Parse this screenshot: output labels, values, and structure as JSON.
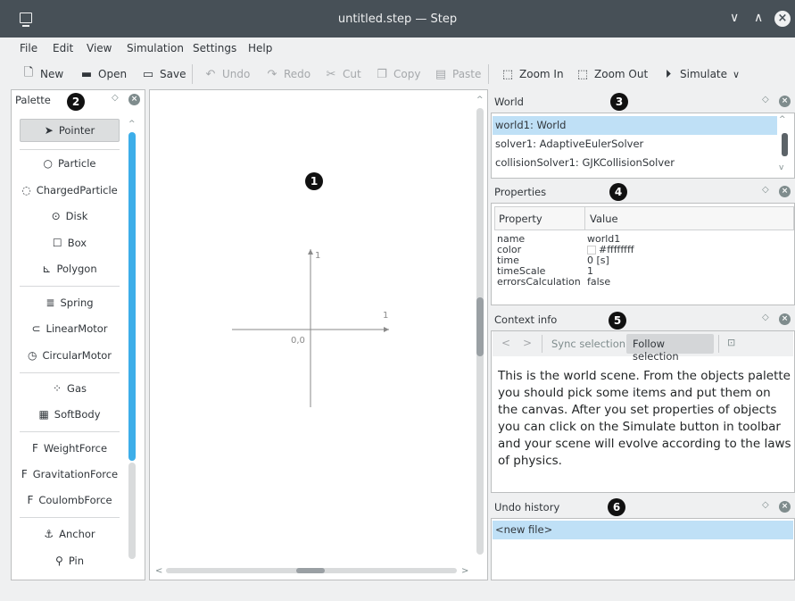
{
  "window": {
    "title": "untitled.step — Step",
    "minimize": "∨",
    "maximize": "∧",
    "close": "×"
  },
  "menu": [
    "File",
    "Edit",
    "View",
    "Simulation",
    "Settings",
    "Help"
  ],
  "toolbar": {
    "new": "New",
    "open": "Open",
    "save": "Save",
    "undo": "Undo",
    "redo": "Redo",
    "cut": "Cut",
    "copy": "Copy",
    "paste": "Paste",
    "zoom_in": "Zoom In",
    "zoom_out": "Zoom Out",
    "simulate": "Simulate",
    "more": "∨"
  },
  "palette": {
    "title": "Palette",
    "badge": "2",
    "items": [
      {
        "label": "Pointer",
        "icon": "pointer-icon",
        "glyph": "➤"
      },
      {
        "label": "Particle",
        "icon": "particle-icon",
        "glyph": "○"
      },
      {
        "label": "ChargedParticle",
        "icon": "charged-particle-icon",
        "glyph": "◌"
      },
      {
        "label": "Disk",
        "icon": "disk-icon",
        "glyph": "⊙"
      },
      {
        "label": "Box",
        "icon": "box-icon",
        "glyph": "☐"
      },
      {
        "label": "Polygon",
        "icon": "polygon-icon",
        "glyph": "⊾"
      },
      {
        "label": "Spring",
        "icon": "spring-icon",
        "glyph": "≣"
      },
      {
        "label": "LinearMotor",
        "icon": "linear-motor-icon",
        "glyph": "⊂"
      },
      {
        "label": "CircularMotor",
        "icon": "circular-motor-icon",
        "glyph": "◷"
      },
      {
        "label": "Gas",
        "icon": "gas-icon",
        "glyph": "⁘"
      },
      {
        "label": "SoftBody",
        "icon": "soft-body-icon",
        "glyph": "▦"
      },
      {
        "label": "WeightForce",
        "icon": "weight-force-icon",
        "glyph": "F"
      },
      {
        "label": "GravitationForce",
        "icon": "gravitation-force-icon",
        "glyph": "F"
      },
      {
        "label": "CoulombForce",
        "icon": "coulomb-force-icon",
        "glyph": "F"
      },
      {
        "label": "Anchor",
        "icon": "anchor-icon",
        "glyph": "⚓"
      },
      {
        "label": "Pin",
        "icon": "pin-icon",
        "glyph": "⚲"
      }
    ]
  },
  "canvas": {
    "badge": "1",
    "axis_y_label": "1",
    "axis_x_label": "1",
    "origin_label": "0,0"
  },
  "world": {
    "title": "World",
    "badge": "3",
    "items": [
      "world1: World",
      "solver1: AdaptiveEulerSolver",
      "collisionSolver1: GJKCollisionSolver"
    ]
  },
  "properties": {
    "title": "Properties",
    "badge": "4",
    "col_property": "Property",
    "col_value": "Value",
    "rows": [
      {
        "name": "name",
        "value": "world1"
      },
      {
        "name": "color",
        "value": "#ffffffff"
      },
      {
        "name": "time",
        "value": "0 [s]"
      },
      {
        "name": "timeScale",
        "value": "1"
      },
      {
        "name": "errorsCalculation",
        "value": "false"
      }
    ],
    "color_swatch": "#ffffff"
  },
  "context": {
    "title": "Context info",
    "badge": "5",
    "back": "<",
    "forward": ">",
    "sync": "Sync selection",
    "follow": "Follow selection",
    "text": "This is the world scene. From the objects palette you should pick some items and put them on the canvas. After you set properties of objects you can click on the Simulate button in toolbar and your scene will evolve according to the laws of physics."
  },
  "undo": {
    "title": "Undo history",
    "badge": "6",
    "items": [
      "<new file>"
    ]
  },
  "colors": {
    "accent": "#3daee9",
    "selection": "#bfe0f6",
    "titlebar": "#475057"
  }
}
